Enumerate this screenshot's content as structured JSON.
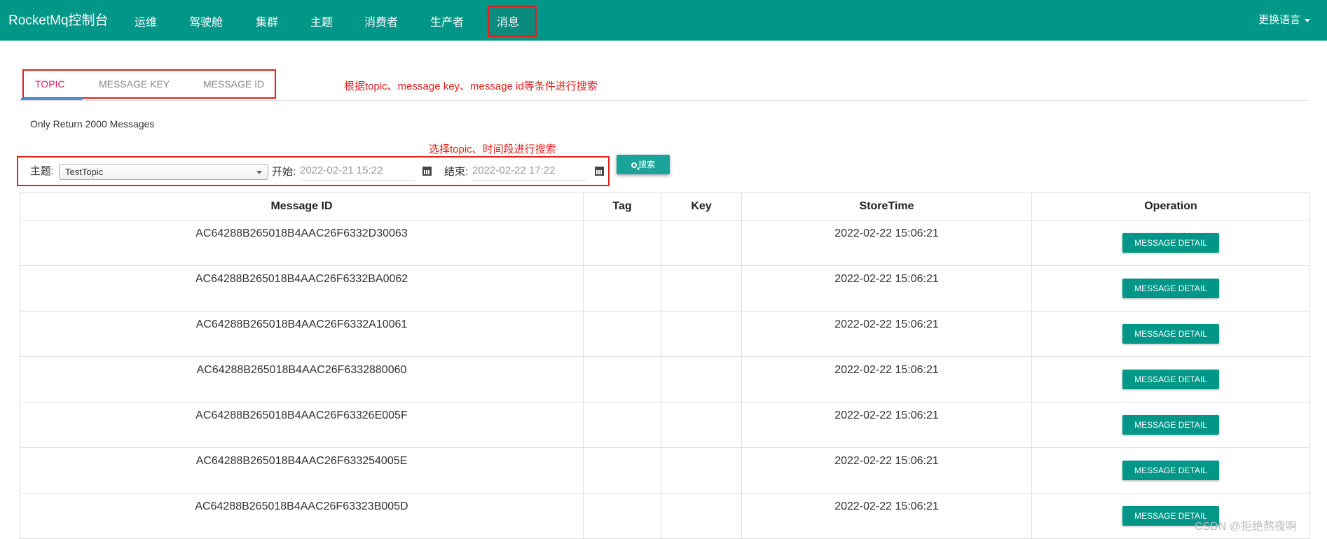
{
  "nav": {
    "brand": "RocketMq控制台",
    "items": [
      "运维",
      "驾驶舱",
      "集群",
      "主题",
      "消费者",
      "生产者",
      "消息"
    ],
    "active_index": 6,
    "language_label": "更换语言"
  },
  "tabs": [
    {
      "label": "TOPIC",
      "active": true
    },
    {
      "label": "MESSAGE KEY",
      "active": false
    },
    {
      "label": "MESSAGE ID",
      "active": false
    }
  ],
  "annotations": {
    "tabs_note": "根据topic、message key、message id等条件进行搜索",
    "filter_note": "选择topic、时间段进行搜索"
  },
  "info_text": "Only Return 2000 Messages",
  "filter": {
    "topic_label": "主题:",
    "topic_value": "TestTopic",
    "start_label": "开始:",
    "start_value": "2022-02-21 15:22",
    "end_label": "结束:",
    "end_value": "2022-02-22 17:22",
    "search_label": "搜索"
  },
  "table": {
    "columns": [
      "Message ID",
      "Tag",
      "Key",
      "StoreTime",
      "Operation"
    ],
    "button_label": "MESSAGE DETAIL",
    "rows": [
      {
        "message_id": "AC64288B265018B4AAC26F6332D30063",
        "tag": "",
        "key": "",
        "store_time": "2022-02-22 15:06:21"
      },
      {
        "message_id": "AC64288B265018B4AAC26F6332BA0062",
        "tag": "",
        "key": "",
        "store_time": "2022-02-22 15:06:21"
      },
      {
        "message_id": "AC64288B265018B4AAC26F6332A10061",
        "tag": "",
        "key": "",
        "store_time": "2022-02-22 15:06:21"
      },
      {
        "message_id": "AC64288B265018B4AAC26F6332880060",
        "tag": "",
        "key": "",
        "store_time": "2022-02-22 15:06:21"
      },
      {
        "message_id": "AC64288B265018B4AAC26F63326E005F",
        "tag": "",
        "key": "",
        "store_time": "2022-02-22 15:06:21"
      },
      {
        "message_id": "AC64288B265018B4AAC26F633254005E",
        "tag": "",
        "key": "",
        "store_time": "2022-02-22 15:06:21"
      },
      {
        "message_id": "AC64288B265018B4AAC26F63323B005D",
        "tag": "",
        "key": "",
        "store_time": "2022-02-22 15:06:21"
      }
    ]
  },
  "watermark": "CSDN @拒绝熬夜啊",
  "colors": {
    "primary": "#009688",
    "annotation": "#e0201f",
    "active_tab": "#e91e63"
  }
}
